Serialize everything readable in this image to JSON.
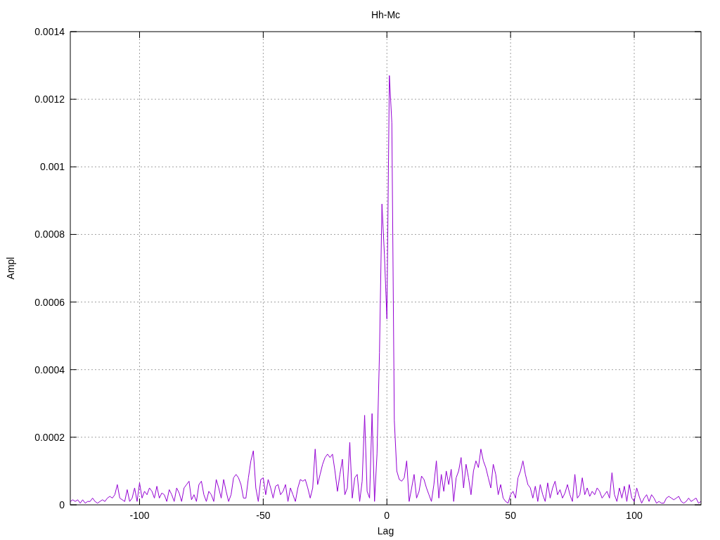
{
  "chart_data": {
    "type": "line",
    "grid": true,
    "title": "Hh-Mc",
    "xlabel": "Lag",
    "ylabel": "Ampl",
    "xlim": [
      -128,
      127
    ],
    "ylim": [
      0,
      0.0014
    ],
    "xticks": [
      -100,
      -50,
      0,
      50,
      100
    ],
    "yticks": [
      0,
      0.0002,
      0.0004,
      0.0006,
      0.0008,
      0.001,
      0.0012,
      0.0014
    ],
    "x": [
      -128,
      -127,
      -126,
      -125,
      -124,
      -123,
      -122,
      -121,
      -120,
      -119,
      -118,
      -117,
      -116,
      -115,
      -114,
      -113,
      -112,
      -111,
      -110,
      -109,
      -108,
      -107,
      -106,
      -105,
      -104,
      -103,
      -102,
      -101,
      -100,
      -99,
      -98,
      -97,
      -96,
      -95,
      -94,
      -93,
      -92,
      -91,
      -90,
      -89,
      -88,
      -87,
      -86,
      -85,
      -84,
      -83,
      -82,
      -81,
      -80,
      -79,
      -78,
      -77,
      -76,
      -75,
      -74,
      -73,
      -72,
      -71,
      -70,
      -69,
      -68,
      -67,
      -66,
      -65,
      -64,
      -63,
      -62,
      -61,
      -60,
      -59,
      -58,
      -57,
      -56,
      -55,
      -54,
      -53,
      -52,
      -51,
      -50,
      -49,
      -48,
      -47,
      -46,
      -45,
      -44,
      -43,
      -42,
      -41,
      -40,
      -39,
      -38,
      -37,
      -36,
      -35,
      -34,
      -33,
      -32,
      -31,
      -30,
      -29,
      -28,
      -27,
      -26,
      -25,
      -24,
      -23,
      -22,
      -21,
      -20,
      -19,
      -18,
      -17,
      -16,
      -15,
      -14,
      -13,
      -12,
      -11,
      -10,
      -9,
      -8,
      -7,
      -6,
      -5,
      -4,
      -3,
      -2,
      -1,
      0,
      1,
      2,
      3,
      4,
      5,
      6,
      7,
      8,
      9,
      10,
      11,
      12,
      13,
      14,
      15,
      16,
      17,
      18,
      19,
      20,
      21,
      22,
      23,
      24,
      25,
      26,
      27,
      28,
      29,
      30,
      31,
      32,
      33,
      34,
      35,
      36,
      37,
      38,
      39,
      40,
      41,
      42,
      43,
      44,
      45,
      46,
      47,
      48,
      49,
      50,
      51,
      52,
      53,
      54,
      55,
      56,
      57,
      58,
      59,
      60,
      61,
      62,
      63,
      64,
      65,
      66,
      67,
      68,
      69,
      70,
      71,
      72,
      73,
      74,
      75,
      76,
      77,
      78,
      79,
      80,
      81,
      82,
      83,
      84,
      85,
      86,
      87,
      88,
      89,
      90,
      91,
      92,
      93,
      94,
      95,
      96,
      97,
      98,
      99,
      100,
      101,
      102,
      103,
      104,
      105,
      106,
      107,
      108,
      109,
      110,
      111,
      112,
      113,
      114,
      115,
      116,
      117,
      118,
      119,
      120,
      121,
      122,
      123,
      124,
      125,
      126,
      127
    ],
    "series": [
      {
        "color": "#9400d3",
        "values": [
          1e-05,
          1.5e-05,
          1e-05,
          1.5e-05,
          5e-06,
          1.5e-05,
          5e-06,
          1e-05,
          1e-05,
          2e-05,
          1e-05,
          5e-06,
          1e-05,
          1.5e-05,
          1e-05,
          2e-05,
          2.5e-05,
          2e-05,
          3e-05,
          6e-05,
          2e-05,
          1.5e-05,
          1e-05,
          4.5e-05,
          1e-05,
          2e-05,
          5e-05,
          1e-05,
          6.5e-05,
          2e-05,
          4e-05,
          3e-05,
          5e-05,
          4e-05,
          2e-05,
          5.5e-05,
          2e-05,
          3.5e-05,
          3e-05,
          1e-05,
          4.5e-05,
          3e-05,
          1e-05,
          5e-05,
          3.5e-05,
          1e-05,
          5e-05,
          6e-05,
          7e-05,
          1.5e-05,
          3e-05,
          1e-05,
          6e-05,
          7e-05,
          3e-05,
          1e-05,
          4e-05,
          3e-05,
          1e-05,
          7.5e-05,
          5e-05,
          2e-05,
          7.5e-05,
          4e-05,
          1e-05,
          3e-05,
          8e-05,
          9e-05,
          8e-05,
          6e-05,
          2e-05,
          2e-05,
          8e-05,
          0.00013,
          0.00016,
          5e-05,
          1e-05,
          7.5e-05,
          8e-05,
          3e-05,
          7.5e-05,
          5e-05,
          2e-05,
          5.5e-05,
          6e-05,
          3e-05,
          4e-05,
          6e-05,
          1e-05,
          5e-05,
          3e-05,
          1e-05,
          5e-05,
          7.5e-05,
          7e-05,
          7.5e-05,
          5e-05,
          2e-05,
          5e-05,
          0.000165,
          6e-05,
          9e-05,
          0.00012,
          0.00014,
          0.00015,
          0.00014,
          0.00015,
          0.0001,
          4e-05,
          9e-05,
          0.000135,
          3e-05,
          5e-05,
          0.000185,
          2e-05,
          8e-05,
          9e-05,
          1e-05,
          7e-05,
          0.000265,
          4e-05,
          2e-05,
          0.00027,
          1e-05,
          0.00015,
          0.00045,
          0.00089,
          0.00074,
          0.00055,
          0.00127,
          0.00113,
          0.00025,
          0.0001,
          7.5e-05,
          7e-05,
          8e-05,
          0.00013,
          1e-05,
          5e-05,
          9e-05,
          2e-05,
          4e-05,
          8.5e-05,
          7.5e-05,
          5e-05,
          3e-05,
          1e-05,
          6e-05,
          0.00013,
          2e-05,
          9e-05,
          4e-05,
          0.0001,
          6e-05,
          0.000105,
          1e-05,
          8e-05,
          0.0001,
          0.00014,
          5e-05,
          0.00012,
          8e-05,
          3e-05,
          0.0001,
          0.00013,
          0.00011,
          0.000165,
          0.00013,
          0.00011,
          8e-05,
          5e-05,
          0.00012,
          9e-05,
          3e-05,
          6e-05,
          2e-05,
          1e-05,
          5e-06,
          3e-05,
          4e-05,
          2e-05,
          8e-05,
          0.0001,
          0.00013,
          9e-05,
          6e-05,
          5e-05,
          2e-05,
          5.5e-05,
          1e-05,
          6e-05,
          3e-05,
          1e-05,
          6.5e-05,
          2e-05,
          5e-05,
          7e-05,
          3e-05,
          4.5e-05,
          2e-05,
          3.5e-05,
          6e-05,
          3e-05,
          1e-05,
          9e-05,
          2e-05,
          3e-05,
          8e-05,
          3e-05,
          5e-05,
          2.5e-05,
          4e-05,
          3e-05,
          5e-05,
          4e-05,
          2e-05,
          3e-05,
          4e-05,
          2e-05,
          9.5e-05,
          3e-05,
          1e-05,
          5e-05,
          2e-05,
          5.5e-05,
          1e-05,
          6e-05,
          2e-05,
          1e-05,
          5e-05,
          2.5e-05,
          5e-06,
          2e-05,
          3e-05,
          1e-05,
          3e-05,
          2e-05,
          5e-06,
          1e-05,
          5e-06,
          5e-06,
          2e-05,
          2.5e-05,
          2e-05,
          1.5e-05,
          2e-05,
          2.5e-05,
          1e-05,
          5e-06,
          1e-05,
          2e-05,
          1e-05,
          1.5e-05,
          2e-05,
          5e-06,
          1e-05
        ]
      }
    ]
  }
}
